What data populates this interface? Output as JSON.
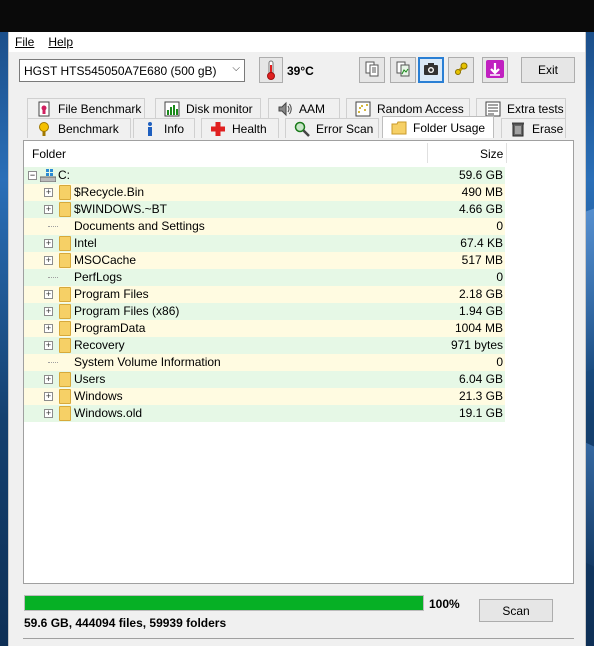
{
  "menu": {
    "file": "File",
    "help": "Help"
  },
  "toolbar": {
    "drive": "HGST HTS545050A7E680 (500 gB)",
    "temperature": "39°C",
    "exit_label": "Exit"
  },
  "tabs": {
    "row1": [
      "File Benchmark",
      "Disk monitor",
      "AAM",
      "Random Access",
      "Extra tests"
    ],
    "row2": [
      "Benchmark",
      "Info",
      "Health",
      "Error Scan",
      "Folder Usage",
      "Erase"
    ],
    "selected": "Folder Usage"
  },
  "table": {
    "col_folder": "Folder",
    "col_size": "Size",
    "root": {
      "name": "C:",
      "size": "59.6 GB"
    },
    "rows": [
      {
        "name": "$Recycle.Bin",
        "size": "490 MB",
        "expandable": true
      },
      {
        "name": "$WINDOWS.~BT",
        "size": "4.66 GB",
        "expandable": true
      },
      {
        "name": "Documents and Settings",
        "size": "0",
        "expandable": false
      },
      {
        "name": "Intel",
        "size": "67.4 KB",
        "expandable": true
      },
      {
        "name": "MSOCache",
        "size": "517 MB",
        "expandable": true
      },
      {
        "name": "PerfLogs",
        "size": "0",
        "expandable": false
      },
      {
        "name": "Program Files",
        "size": "2.18 GB",
        "expandable": true
      },
      {
        "name": "Program Files (x86)",
        "size": "1.94 GB",
        "expandable": true
      },
      {
        "name": "ProgramData",
        "size": "1004 MB",
        "expandable": true
      },
      {
        "name": "Recovery",
        "size": "971 bytes",
        "expandable": true
      },
      {
        "name": "System Volume Information",
        "size": "0",
        "expandable": false
      },
      {
        "name": "Users",
        "size": "6.04 GB",
        "expandable": true
      },
      {
        "name": "Windows",
        "size": "21.3 GB",
        "expandable": true
      },
      {
        "name": "Windows.old",
        "size": "19.1 GB",
        "expandable": true
      }
    ]
  },
  "progress": {
    "percent_label": "100%",
    "fraction": 1.0
  },
  "scan_label": "Scan",
  "summary": "59.6 GB, 444094 files, 59939 folders",
  "colors": {
    "row_green": "#e6f8e6",
    "row_yellow": "#fffbe1",
    "progress": "#06b025"
  }
}
